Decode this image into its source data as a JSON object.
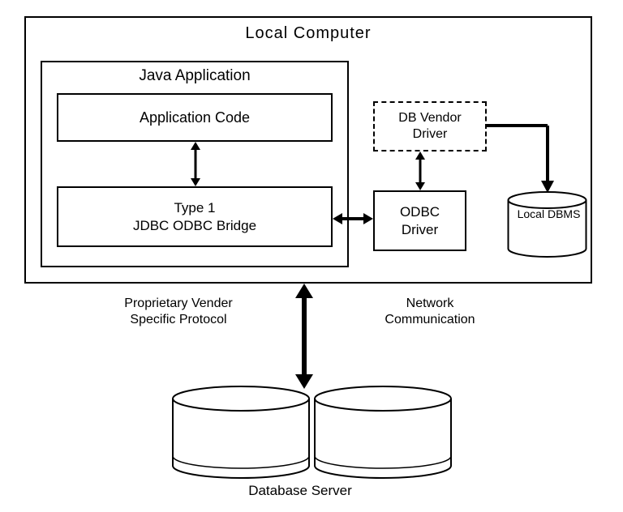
{
  "title": "Local  Computer",
  "java_app": {
    "title": "Java Application",
    "app_code": "Application Code",
    "bridge_line1": "Type 1",
    "bridge_line2": "JDBC ODBC Bridge"
  },
  "odbc": {
    "line1": "ODBC",
    "line2": "Driver"
  },
  "db_vendor": {
    "line1": "DB Vendor",
    "line2": "Driver"
  },
  "local_dbms": "Local DBMS",
  "labels": {
    "proprietary_line1": "Proprietary Vender",
    "proprietary_line2": "Specific Protocol",
    "network_line1": "Network",
    "network_line2": "Communication",
    "db_server": "Database Server"
  }
}
